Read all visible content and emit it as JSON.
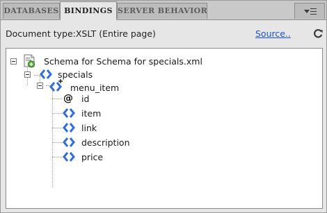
{
  "tabs": [
    {
      "label": "DATABASES",
      "active": false
    },
    {
      "label": "BINDINGS",
      "active": true
    },
    {
      "label": "SERVER BEHAVIORS",
      "active": false
    }
  ],
  "panel_menu": {
    "icon": "panel-options-menu-icon"
  },
  "document": {
    "doctype_text": "Document type:XSLT (Entire page)",
    "source_link": "Source..",
    "refresh_icon": "refresh-icon"
  },
  "tree": {
    "root": {
      "label": "Schema for Schema for specials.xml",
      "icon": "xml-schema-icon"
    },
    "specials": {
      "label": "specials",
      "icon": "element-icon"
    },
    "menu_item": {
      "label": "menu_item",
      "icon": "repeating-element-icon"
    },
    "children": [
      {
        "label": "id",
        "icon": "attribute-icon"
      },
      {
        "label": "item",
        "icon": "element-icon"
      },
      {
        "label": "link",
        "icon": "element-icon"
      },
      {
        "label": "description",
        "icon": "element-icon"
      },
      {
        "label": "price",
        "icon": "element-icon"
      }
    ]
  },
  "colors": {
    "element_icon_blue": "#2f6fd6",
    "link_blue": "#1d52c4",
    "panel_gray": "#e6e6e6"
  }
}
